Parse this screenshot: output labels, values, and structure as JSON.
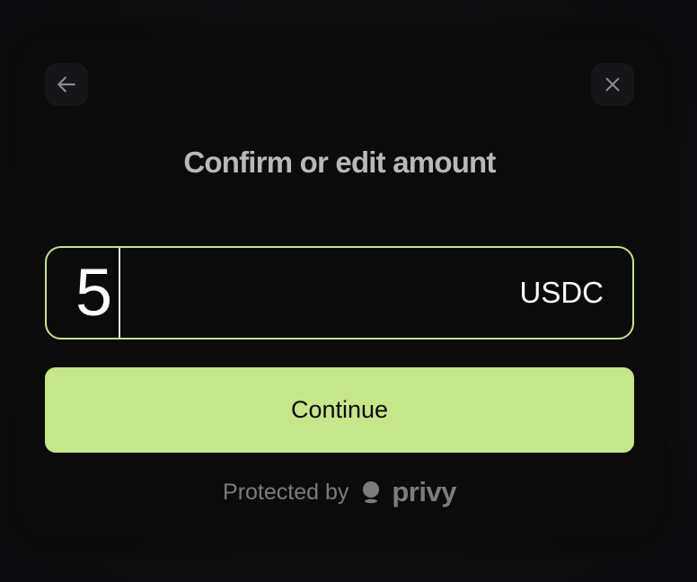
{
  "modal": {
    "title": "Confirm or edit amount",
    "back_icon": "arrow-left-icon",
    "close_icon": "close-icon"
  },
  "amount": {
    "value": "5",
    "currency": "USDC"
  },
  "actions": {
    "continue_label": "Continue"
  },
  "footer": {
    "protected_text": "Protected by",
    "brand": "privy"
  },
  "colors": {
    "accent": "#c6e68b",
    "background": "#0b0b0c",
    "muted_text": "#7c7c80"
  }
}
